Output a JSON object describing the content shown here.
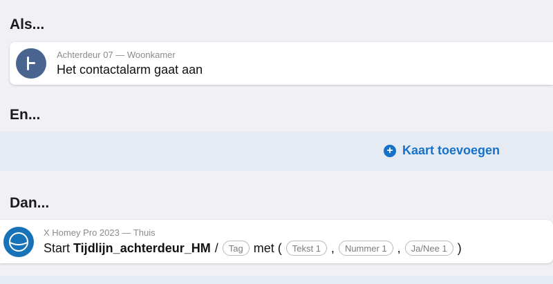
{
  "sections": {
    "als": "Als...",
    "en": "En...",
    "dan": "Dan..."
  },
  "trigger_card": {
    "subtitle": "Achterdeur 07 — Woonkamer",
    "text": "Het contactalarm gaat aan",
    "icon": "door-handle-icon",
    "icon_bg": "#4a6490"
  },
  "add_card": {
    "label": "Kaart toevoegen",
    "icon": "plus-circle-icon",
    "color": "#1572c8"
  },
  "action_card": {
    "subtitle": "X Homey Pro 2023 — Thuis",
    "start": "Start",
    "flow_name": "Tijdlijn_achterdeur_HM",
    "slash": "/",
    "tag_label": "Tag",
    "met": "met (",
    "arg1": "Tekst 1",
    "comma1": ",",
    "arg2": "Nummer 1",
    "comma2": ",",
    "arg3": "Ja/Nee 1",
    "close": ")",
    "icon": "homey-icon",
    "icon_bg": "#1872b8"
  }
}
